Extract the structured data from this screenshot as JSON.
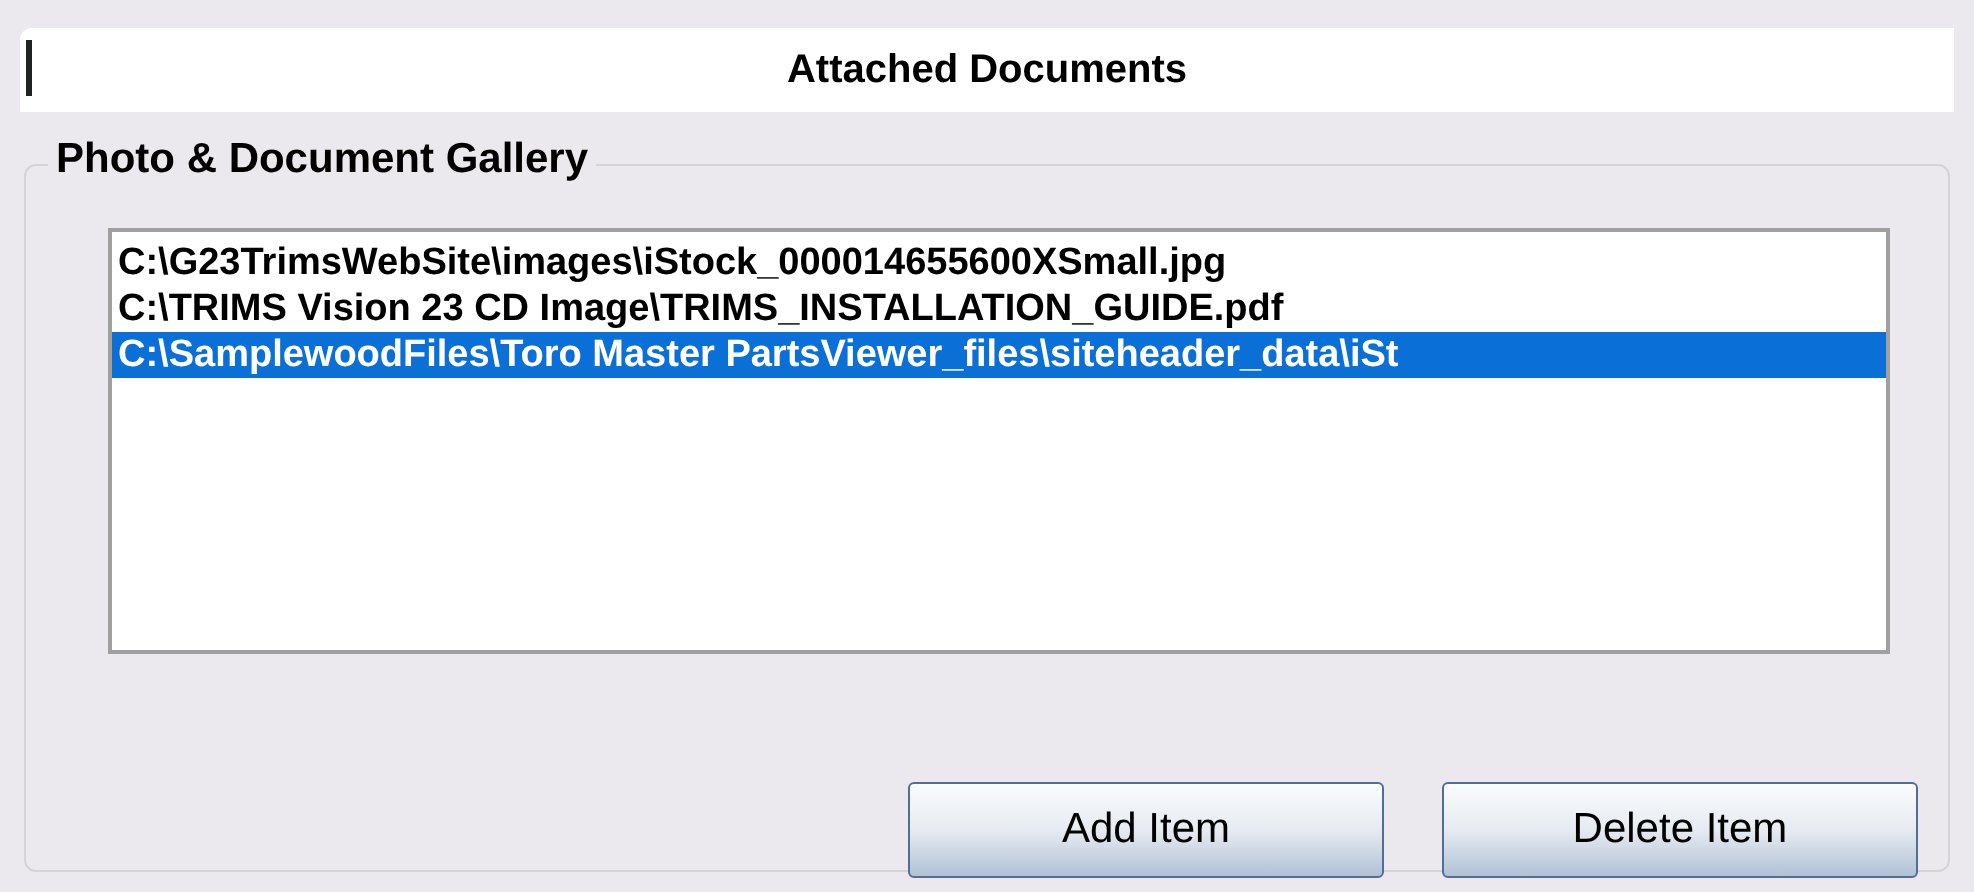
{
  "header": {
    "title": "Attached Documents"
  },
  "gallery": {
    "title": "Photo & Document Gallery",
    "items": [
      {
        "path": "C:\\G23TrimsWebSite\\images\\iStock_000014655600XSmall.jpg",
        "selected": false
      },
      {
        "path": "C:\\TRIMS Vision 23 CD Image\\TRIMS_INSTALLATION_GUIDE.pdf",
        "selected": false
      },
      {
        "path": "C:\\SamplewoodFiles\\Toro Master PartsViewer_files\\siteheader_data\\iSt",
        "selected": true
      }
    ],
    "buttons": [
      "Add Item",
      "Delete Item"
    ]
  }
}
